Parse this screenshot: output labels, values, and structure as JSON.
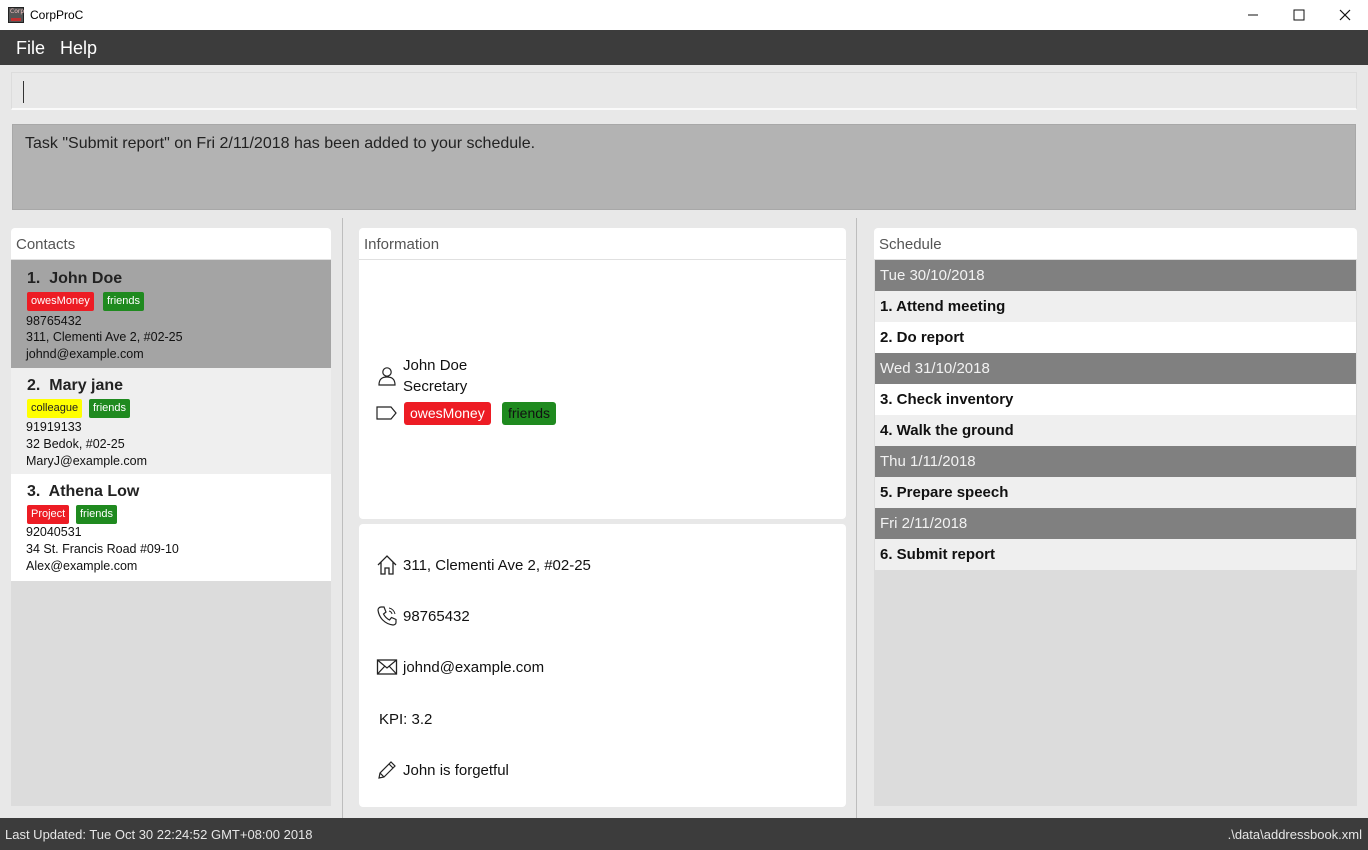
{
  "window": {
    "title": "CorpProC",
    "icon_text": "Corp"
  },
  "menu": {
    "file": "File",
    "help": "Help"
  },
  "command": {
    "value": ""
  },
  "result": {
    "text": "Task \"Submit report\" on Fri 2/11/2018 has been added to your schedule."
  },
  "contacts": {
    "header": "Contacts",
    "items": [
      {
        "index": "1.",
        "name": "John Doe",
        "tags": [
          "owesMoney",
          "friends"
        ],
        "phone": "98765432",
        "address": "311, Clementi Ave 2, #02-25",
        "email": "johnd@example.com",
        "selected": true
      },
      {
        "index": "2.",
        "name": "Mary jane",
        "tags": [
          "colleague",
          "friends"
        ],
        "phone": "91919133",
        "address": "32 Bedok, #02-25",
        "email": "MaryJ@example.com"
      },
      {
        "index": "3.",
        "name": "Athena Low",
        "tags": [
          "Project",
          "friends"
        ],
        "phone": "92040531",
        "address": "34 St. Francis Road #09-10",
        "email": "Alex@example.com"
      }
    ]
  },
  "information": {
    "header": "Information",
    "name": "John Doe",
    "role": "Secretary",
    "tags": [
      "owesMoney",
      "friends"
    ],
    "address": "311, Clementi Ave 2, #02-25",
    "phone": "98765432",
    "email": "johnd@example.com",
    "kpi": "KPI: 3.2",
    "note": "John is forgetful"
  },
  "schedule": {
    "header": "Schedule",
    "rows": [
      {
        "kind": "date",
        "text": "Tue 30/10/2018"
      },
      {
        "kind": "task",
        "text": "1. Attend meeting"
      },
      {
        "kind": "task",
        "text": "2. Do report"
      },
      {
        "kind": "date",
        "text": "Wed 31/10/2018"
      },
      {
        "kind": "task",
        "text": "3. Check inventory"
      },
      {
        "kind": "task",
        "text": "4. Walk the ground"
      },
      {
        "kind": "date",
        "text": "Thu 1/11/2018"
      },
      {
        "kind": "task",
        "text": "5. Prepare speech"
      },
      {
        "kind": "date",
        "text": "Fri 2/11/2018"
      },
      {
        "kind": "task",
        "text": "6. Submit report"
      }
    ]
  },
  "status": {
    "last_updated": "Last Updated: Tue Oct 30 22:24:52 GMT+08:00 2018",
    "file_path": ".\\data\\addressbook.xml"
  },
  "colors": {
    "menubar": "#3c3c3c",
    "tag_red": "#ed1c24",
    "tag_green": "#1f8a1f",
    "tag_yellow": "#ffff00",
    "date_row": "#808080",
    "selected_card": "#a4a4a4"
  },
  "icons": {
    "person": "person-icon",
    "tag": "tag-icon",
    "home": "home-icon",
    "phone": "phone-icon",
    "email": "mail-icon",
    "note": "pencil-icon"
  }
}
